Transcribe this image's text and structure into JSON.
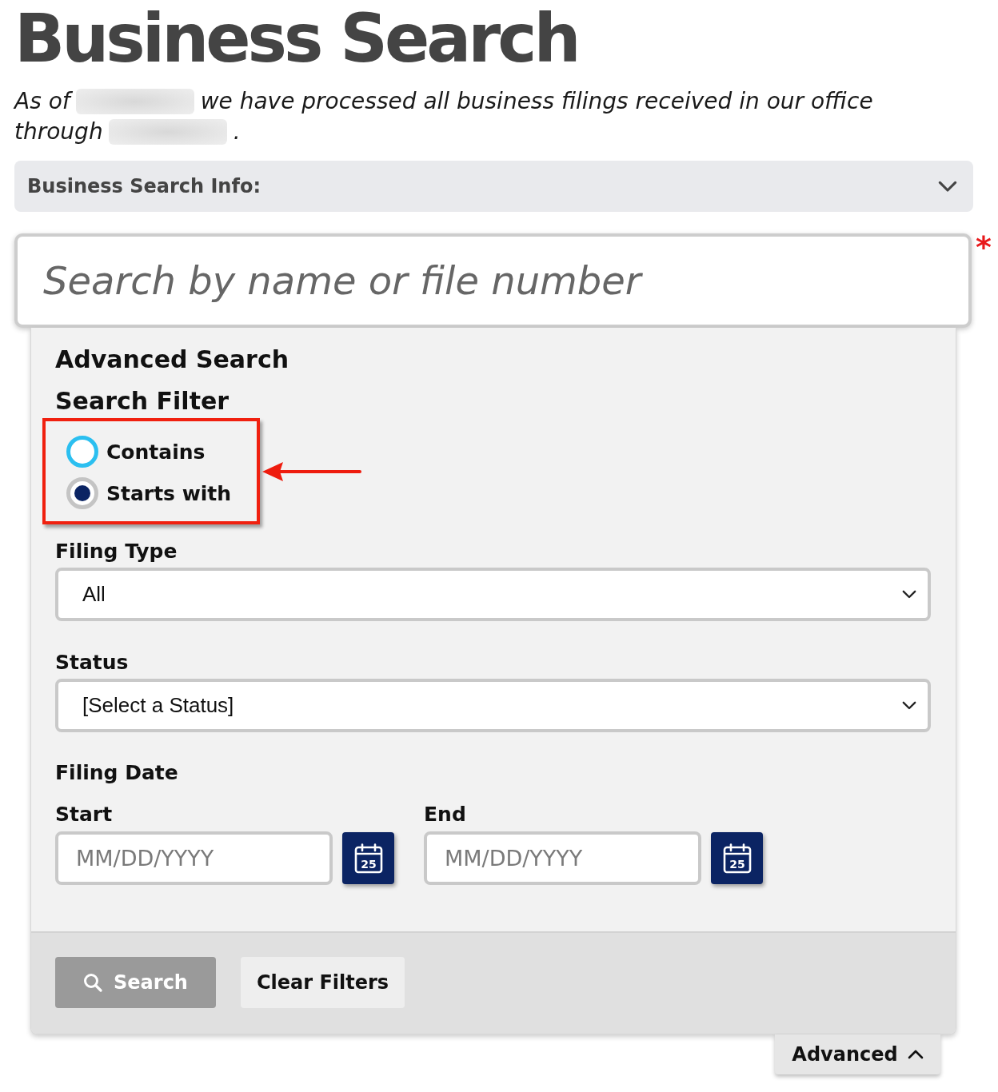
{
  "title": "Business Search",
  "intro": {
    "lines": [
      [
        {
          "kind": "text",
          "text": "As of"
        },
        {
          "kind": "redacted"
        },
        {
          "kind": "text",
          "text": "we have processed all business filings received in our office"
        }
      ],
      [
        {
          "kind": "text",
          "text": "through"
        },
        {
          "kind": "redacted"
        },
        {
          "kind": "text",
          "text": "."
        }
      ]
    ]
  },
  "info_panel": {
    "label": "Business Search Info:",
    "expanded": false
  },
  "search_field": {
    "placeholder": "Search by name or file number",
    "required_mark": "*"
  },
  "advanced_search": {
    "heading": "Advanced Search",
    "filter_heading": "Search Filter",
    "filter_options": [
      {
        "label": "Contains",
        "selected": false
      },
      {
        "label": "Starts with",
        "selected": true
      }
    ],
    "selects": [
      {
        "label": "Filing Type",
        "value": "All"
      },
      {
        "label": "Status",
        "value": "[Select a Status]"
      }
    ],
    "filing_date": {
      "label": "Filing Date",
      "fields": [
        {
          "label": "Start",
          "placeholder": "MM/DD/YYYY",
          "calendar_day": "25"
        },
        {
          "label": "End",
          "placeholder": "MM/DD/YYYY",
          "calendar_day": "25"
        }
      ]
    },
    "buttons": [
      {
        "label": "Search",
        "kind": "search",
        "disabled": true
      },
      {
        "label": "Clear Filters",
        "kind": "plain",
        "disabled": false
      }
    ]
  },
  "advanced_toggle": {
    "label": "Advanced",
    "expanded": true
  }
}
